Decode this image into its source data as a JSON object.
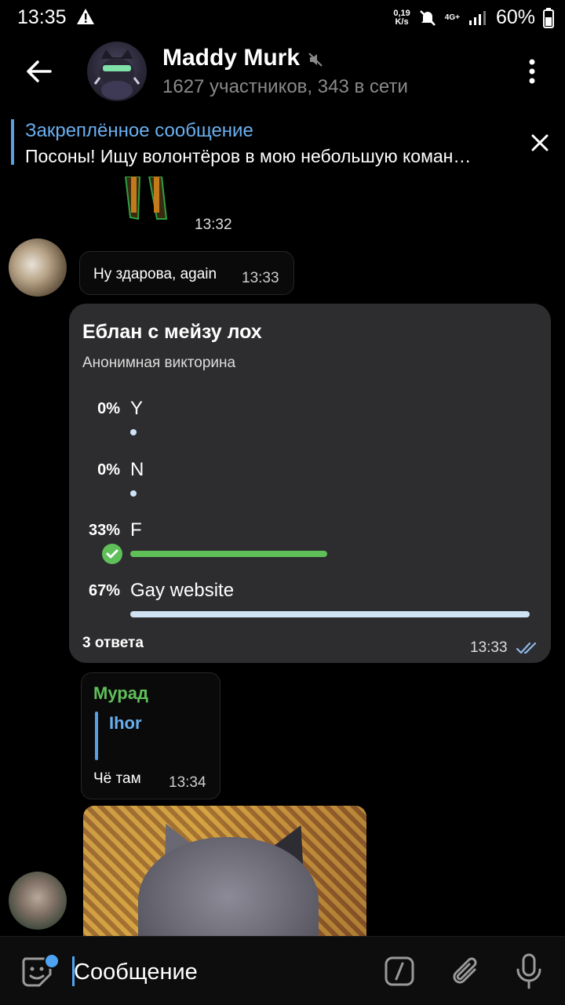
{
  "status_bar": {
    "time": "13:35",
    "speed_value": "0,19",
    "speed_unit": "K/s",
    "network": "4G+",
    "battery": "60%"
  },
  "header": {
    "title": "Maddy Murk",
    "subtitle": "1627 участников, 343 в сети"
  },
  "pinned": {
    "title": "Закреплённое сообщение",
    "text": "Посоны! Ищу волонтёров в мою небольшую коман…"
  },
  "messages": {
    "prev_time": "13:32",
    "msg1": {
      "text": "Ну здарова, again",
      "time": "13:33"
    },
    "poll": {
      "question": "Еблан с мейзу лох",
      "type": "Анонимная викторина",
      "options": [
        {
          "percent": "0%",
          "label": "Y",
          "value": 0,
          "selected": false
        },
        {
          "percent": "0%",
          "label": "N",
          "value": 0,
          "selected": false
        },
        {
          "percent": "33%",
          "label": "F",
          "value": 0.33,
          "selected": true
        },
        {
          "percent": "67%",
          "label": "Gay website",
          "value": 0.67,
          "selected": false
        }
      ],
      "votes": "3 ответа",
      "time": "13:33"
    },
    "msg2": {
      "sender": "Мурад",
      "reply_to": "Ihor",
      "text": "Чё там",
      "time": "13:34"
    }
  },
  "input": {
    "placeholder": "Сообщение"
  },
  "colors": {
    "accent_blue": "#5aa0e0",
    "green": "#5fc05a",
    "poll_bg": "#2d2d2f"
  }
}
